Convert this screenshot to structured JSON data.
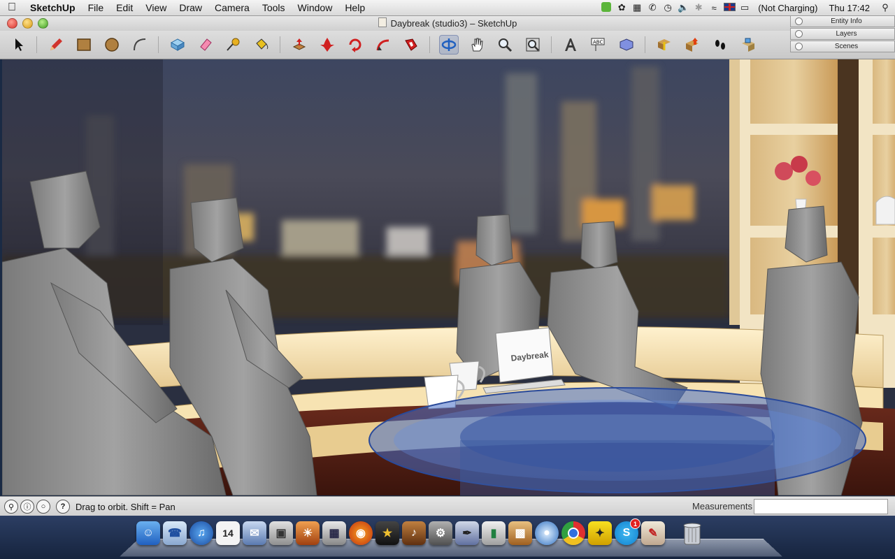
{
  "menubar": {
    "app_name": "SketchUp",
    "items": [
      "File",
      "Edit",
      "View",
      "Draw",
      "Camera",
      "Tools",
      "Window",
      "Help"
    ],
    "battery_status": "(Not Charging)",
    "clock": "Thu 17:42"
  },
  "window": {
    "title": "Daybreak (studio3) – SketchUp"
  },
  "panels": [
    "Entity Info",
    "Layers",
    "Scenes"
  ],
  "scene": {
    "laptop_label": "Daybreak"
  },
  "statusbar": {
    "hint": "Drag to orbit.  Shift = Pan",
    "measurements_label": "Measurements",
    "measurements_value": ""
  },
  "dock": {
    "calendar_day": "14",
    "skype_badge": "1"
  },
  "colors": {
    "active_tool": "#5a78b4",
    "glass_table": "#4a6fbf",
    "figure_grey": "#8c8c8c",
    "bench": "#f0ddb0"
  }
}
